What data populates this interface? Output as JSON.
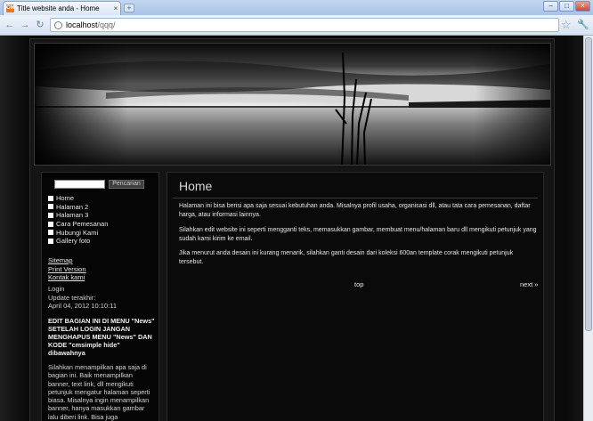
{
  "browser": {
    "tab_title": "Title website anda - Home",
    "favicon_text": "CM",
    "tab_close": "×",
    "new_tab": "+",
    "window_buttons": [
      "–",
      "□",
      "×"
    ],
    "back": "←",
    "forward": "→",
    "reload": "↻",
    "url_host": "localhost",
    "url_path": "/qqq/",
    "star": "☆",
    "wrench": "🔧"
  },
  "sidebar": {
    "search_placeholder": "",
    "search_button": "Pencarian",
    "menu": [
      "Home",
      "Halaman 2",
      "Halaman 3",
      "Cara Pemesanan",
      "Hubungi Kami",
      "Gallery foto"
    ],
    "links": [
      "Sitemap",
      "Print Version",
      "Kontak kami"
    ],
    "login_label": "Login",
    "update_label": "Update terakhir:",
    "update_date": "April 04, 2012 10:10:11",
    "edit_note": "EDIT BAGIAN INI DI MENU \"News\" SETELAH LOGIN JANGAN MENGHAPUS MENU \"News\" DAN KODE \"cmsimple hide\" dibawahnya",
    "description": "Silahkan menampilkan apa saja di bagian ini. Baik menampilkan banner, text link, dll mengikuti petunjuk mengatur halaman seperti biasa. Misalnya ingin menampilkan banner, hanya masukkan gambar lalu diberi link. Bisa juga menampilkan sesuatu yang berbasis script, seperti Google"
  },
  "content": {
    "title": "Home",
    "paragraphs": [
      "Halaman ini bisa berisi apa saja sesuai kebutuhan anda. Misalnya profil usaha, organisasi dll, atau tata cara pemesanan, daftar harga, atau informasi lainnya.",
      "Silahkan edit website ini seperti mengganti teks, memasukkan gambar, membuat menu/halaman baru dll mengikuti petunjuk yang sudah kami kirim ke email.",
      "Jika menurut anda desain ini kurang menarik, silahkan ganti desain dari koleksi 600an template corak mengikuti petunjuk tersebut."
    ],
    "top_link": "top",
    "next_link": "next »"
  }
}
